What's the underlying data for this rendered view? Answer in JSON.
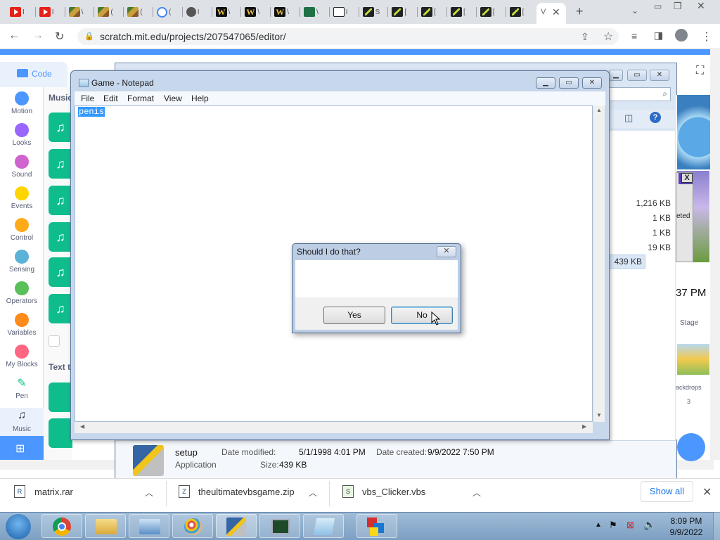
{
  "browser": {
    "url": "scratch.mit.edu/projects/207547065/editor/",
    "tabs": [
      {
        "icon": "youtube-icon",
        "label": "I"
      },
      {
        "icon": "youtube-icon",
        "label": "I"
      },
      {
        "icon": "minecraft-icon",
        "label": "\\"
      },
      {
        "icon": "minecraft-icon",
        "label": "("
      },
      {
        "icon": "minecraft-icon",
        "label": "("
      },
      {
        "icon": "google-icon",
        "label": "("
      },
      {
        "icon": "globe-icon",
        "label": "I"
      },
      {
        "icon": "wikia-icon",
        "label": "\\"
      },
      {
        "icon": "wikia-icon",
        "label": "\\"
      },
      {
        "icon": "wikia-icon",
        "label": "\\"
      },
      {
        "icon": "sheets-icon",
        "label": "\\"
      },
      {
        "icon": "museum-icon",
        "label": "I"
      },
      {
        "icon": "site-icon",
        "label": "S"
      },
      {
        "icon": "site-icon",
        "label": "["
      },
      {
        "icon": "site-icon",
        "label": "["
      },
      {
        "icon": "site-icon",
        "label": "["
      },
      {
        "icon": "site-icon",
        "label": "["
      },
      {
        "icon": "site-icon",
        "label": "["
      }
    ],
    "active_tab_label": "V"
  },
  "scratch": {
    "code_tab": "Code",
    "category_header": "Music",
    "text_header": "Text t",
    "categories": [
      {
        "label": "Motion",
        "color": "#4c97ff"
      },
      {
        "label": "Looks",
        "color": "#9966ff"
      },
      {
        "label": "Sound",
        "color": "#cf63cf"
      },
      {
        "label": "Events",
        "color": "#ffd500"
      },
      {
        "label": "Control",
        "color": "#ffab19"
      },
      {
        "label": "Sensing",
        "color": "#5cb1d6"
      },
      {
        "label": "Operators",
        "color": "#59c059"
      },
      {
        "label": "Variables",
        "color": "#ff8c1a"
      },
      {
        "label": "My Blocks",
        "color": "#ff6680"
      },
      {
        "label": "Pen",
        "color": ""
      },
      {
        "label": "Music",
        "color": ""
      }
    ],
    "stage_label": "Stage",
    "backdrops_label": "ackdrops",
    "backdrops_count": "3",
    "clock_fragment": "37 PM",
    "deleted_fragment": "eted"
  },
  "explorer": {
    "sizes": [
      "1,216 KB",
      "1 KB",
      "1 KB",
      "19 KB",
      "439 KB"
    ],
    "details": {
      "name": "setup",
      "type": "Application",
      "modified_label": "Date modified:",
      "modified": "5/1/1998 4:01 PM",
      "created_label": "Date created:",
      "created": "9/9/2022 7:50 PM",
      "size_label": "Size:",
      "size": "439 KB"
    }
  },
  "notepad": {
    "title": "Game - Notepad",
    "menu": [
      "File",
      "Edit",
      "Format",
      "View",
      "Help"
    ],
    "content": "penis"
  },
  "dialog": {
    "title": "Should I do that?",
    "yes": "Yes",
    "no": "No"
  },
  "downloads": [
    {
      "name": "matrix.rar"
    },
    {
      "name": "theultimatevbsgame.zip"
    },
    {
      "name": "vbs_Clicker.vbs"
    }
  ],
  "downloads_show_all": "Show all",
  "taskbar": {
    "time": "8:09 PM",
    "date": "9/9/2022"
  }
}
